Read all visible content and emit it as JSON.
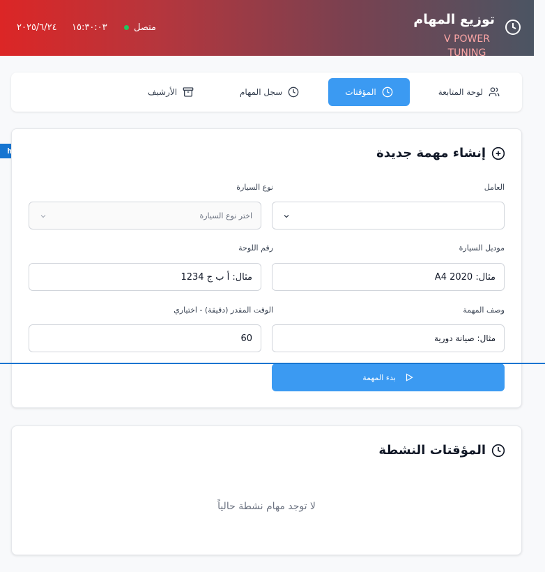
{
  "header": {
    "title": "توزيع المهام",
    "brand_line1": "V POWER",
    "brand_line2": "TUNING",
    "status": "متصل",
    "time": "١٥:٣٠:٠٣",
    "date": "٢٠٢٥/٦/٢٤",
    "status_color": "#22c55e"
  },
  "nav": {
    "items": [
      {
        "label": "لوحة المتابعة",
        "icon": "users-icon"
      },
      {
        "label": "المؤقتات",
        "icon": "clock-icon",
        "active": true
      },
      {
        "label": "سجل المهام",
        "icon": "clock-icon"
      },
      {
        "label": "الأرشيف",
        "icon": "archive-icon"
      }
    ]
  },
  "badge": "html",
  "form": {
    "title": "إنشاء مهمة جديدة",
    "worker_label": "العامل",
    "worker_value": "",
    "car_type_label": "نوع السيارة",
    "car_type_placeholder": "اختر نوع السيارة",
    "car_model_label": "موديل السيارة",
    "car_model_placeholder": "مثال: A4 2020",
    "plate_label": "رقم اللوحة",
    "plate_placeholder": "مثال: أ ب ج 1234",
    "description_label": "وصف المهمة",
    "description_placeholder": "مثال: صيانة دورية",
    "estimate_label": "الوقت المقدر (دقيقة) - اختياري",
    "estimate_value": "60",
    "submit_label": "بدء المهمة"
  },
  "timers": {
    "title": "المؤقتات النشطة",
    "empty_text": "لا توجد مهام نشطة حالياً"
  },
  "colors": {
    "accent": "#3b9af2",
    "header_start": "#dc2626",
    "header_end": "#4b5563"
  }
}
